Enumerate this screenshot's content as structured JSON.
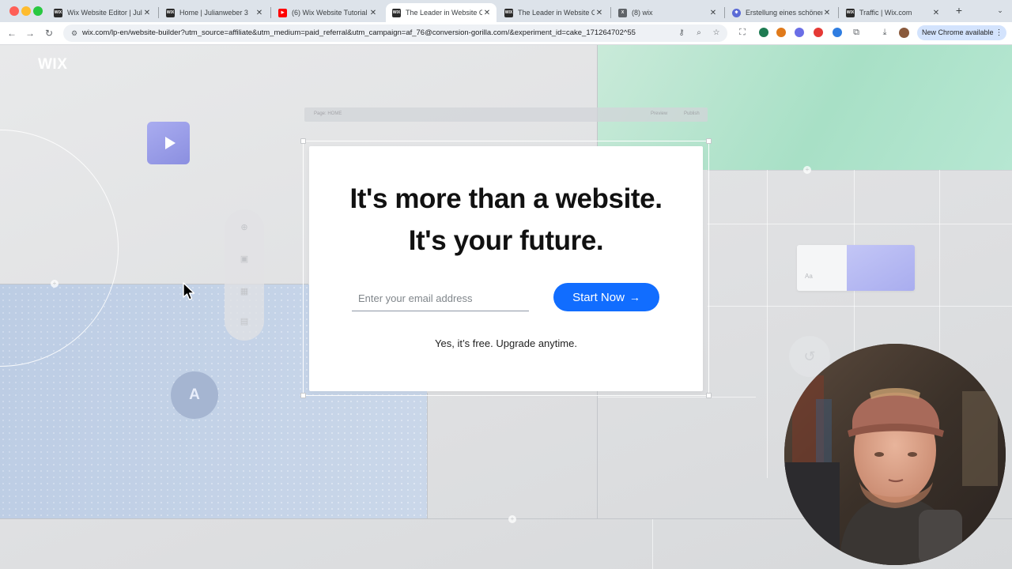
{
  "browser": {
    "tabs": [
      {
        "title": "Wix Website Editor | Julia",
        "favicon": "wix-icon",
        "active": false
      },
      {
        "title": "Home | Julianweber 3",
        "favicon": "wix-icon",
        "active": false
      },
      {
        "title": "(6) Wix Website Tutorial",
        "favicon": "youtube-icon",
        "active": false
      },
      {
        "title": "The Leader in Website Cr",
        "favicon": "wix-icon",
        "active": true
      },
      {
        "title": "The Leader in Website Cr",
        "favicon": "wix-icon",
        "active": false
      },
      {
        "title": "(8) wix",
        "favicon": "x-icon",
        "active": false
      },
      {
        "title": "Erstellung eines schönen",
        "favicon": "gear-icon",
        "active": false
      },
      {
        "title": "Traffic | Wix.com",
        "favicon": "wix-icon",
        "active": false
      }
    ],
    "url": "wix.com/lp-en/website-builder?utm_source=affiliate&utm_medium=paid_referral&utm_campaign=af_76@conversion-gorilla.com/&experiment_id=cake_171264702^55",
    "new_chrome_label": "New Chrome available",
    "accent_color": "#d3e3fd"
  },
  "page": {
    "logo_text": "WIX",
    "headline_line1": "It's more than a website.",
    "headline_line2": "It's your future.",
    "email_placeholder": "Enter your email address",
    "cta_label": "Start Now",
    "cta_color": "#116dff",
    "subtext": "Yes, it’s free. Upgrade anytime.",
    "swatch_label": "Aa",
    "ghost_bar": {
      "left": "Page: HOME",
      "preview": "Preview",
      "publish": "Publish"
    }
  }
}
